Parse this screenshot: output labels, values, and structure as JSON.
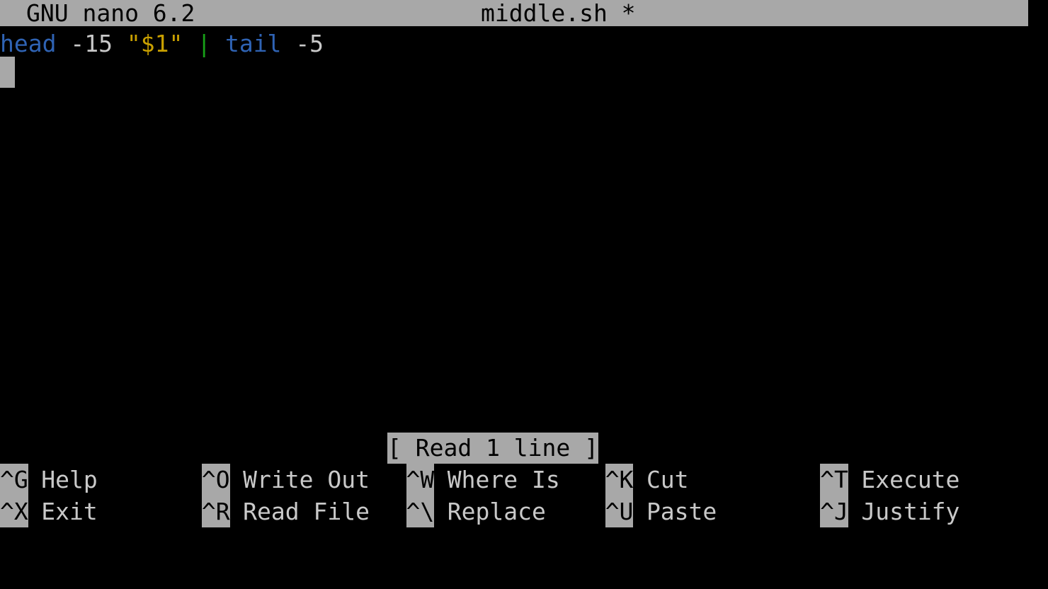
{
  "terminal": {
    "columns": 80,
    "rows": 17,
    "background": "#000000",
    "foreground": "#c9c9c9",
    "inverse_background": "#a8a8a8",
    "inverse_foreground": "#000000"
  },
  "title_bar": {
    "app_version": "GNU nano 6.2",
    "file_name": "middle.sh *"
  },
  "editor": {
    "line_number": 1,
    "code_tokens": [
      {
        "text": "head",
        "color": "#2f63b4",
        "role": "command"
      },
      {
        "text": " ",
        "color": "#c9c9c9",
        "role": "space"
      },
      {
        "text": "-15",
        "color": "#c9c9c9",
        "role": "option"
      },
      {
        "text": " ",
        "color": "#c9c9c9",
        "role": "space"
      },
      {
        "text": "\"$1\"",
        "color": "#c9a000",
        "role": "string"
      },
      {
        "text": " ",
        "color": "#c9c9c9",
        "role": "space"
      },
      {
        "text": "|",
        "color": "#17a017",
        "role": "pipe"
      },
      {
        "text": " ",
        "color": "#c9c9c9",
        "role": "space"
      },
      {
        "text": "tail",
        "color": "#2f63b4",
        "role": "command"
      },
      {
        "text": " ",
        "color": "#c9c9c9",
        "role": "space"
      },
      {
        "text": "-5",
        "color": "#c9c9c9",
        "role": "option"
      }
    ],
    "plain_text": "head -15 \"$1\" | tail -5",
    "cursor": {
      "row": 2,
      "column": 1
    }
  },
  "status_message": "[ Read 1 line ]",
  "shortcut_bar": {
    "row1": [
      {
        "key": "^G",
        "label": "Help",
        "col": 0
      },
      {
        "key": "^O",
        "label": "Write Out",
        "col": 15.4
      },
      {
        "key": "^W",
        "label": "Where Is",
        "col": 31.0
      },
      {
        "key": "^K",
        "label": "Cut",
        "col": 46.2
      },
      {
        "key": "^T",
        "label": "Execute",
        "col": 62.6
      }
    ],
    "row2": [
      {
        "key": "^X",
        "label": "Exit",
        "col": 0
      },
      {
        "key": "^R",
        "label": "Read File",
        "col": 15.4
      },
      {
        "key": "^\\",
        "label": "Replace",
        "col": 31.0
      },
      {
        "key": "^U",
        "label": "Paste",
        "col": 46.2
      },
      {
        "key": "^J",
        "label": "Justify",
        "col": 62.6
      }
    ]
  }
}
